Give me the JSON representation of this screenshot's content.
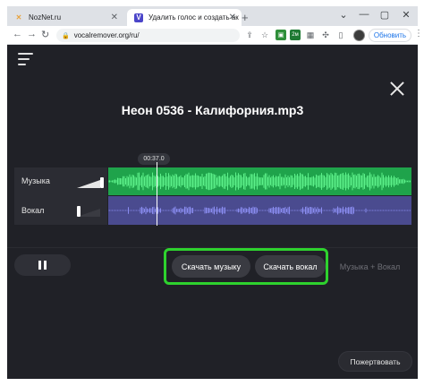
{
  "browser": {
    "tabs": [
      {
        "title": "NozNet.ru"
      },
      {
        "title": "Удалить голос и создать ак"
      }
    ],
    "favicon2_letter": "V",
    "new_tab_glyph": "+",
    "url": "vocalremover.org/ru/",
    "extension_badge": "2м",
    "update_label": "Обновить",
    "window_controls": [
      "chevron-down",
      "minimize",
      "maximize",
      "close"
    ]
  },
  "app": {
    "file_title": "Неон 0536 - Калифорния.mp3",
    "time_badge": "00:37.0",
    "tracks": [
      {
        "label": "Музыка",
        "volume": 1.0,
        "color": "#1fa34b"
      },
      {
        "label": "Вокал",
        "volume": 0.0,
        "color": "#4a4b8f"
      }
    ],
    "playhead_position_fraction": 0.16,
    "buttons": {
      "download_music": "Скачать музыку",
      "download_vocal": "Скачать вокал",
      "music_plus_vocal": "Музыка + Вокал",
      "donate": "Пожертвовать"
    },
    "highlight_color": "#2ed22e"
  }
}
